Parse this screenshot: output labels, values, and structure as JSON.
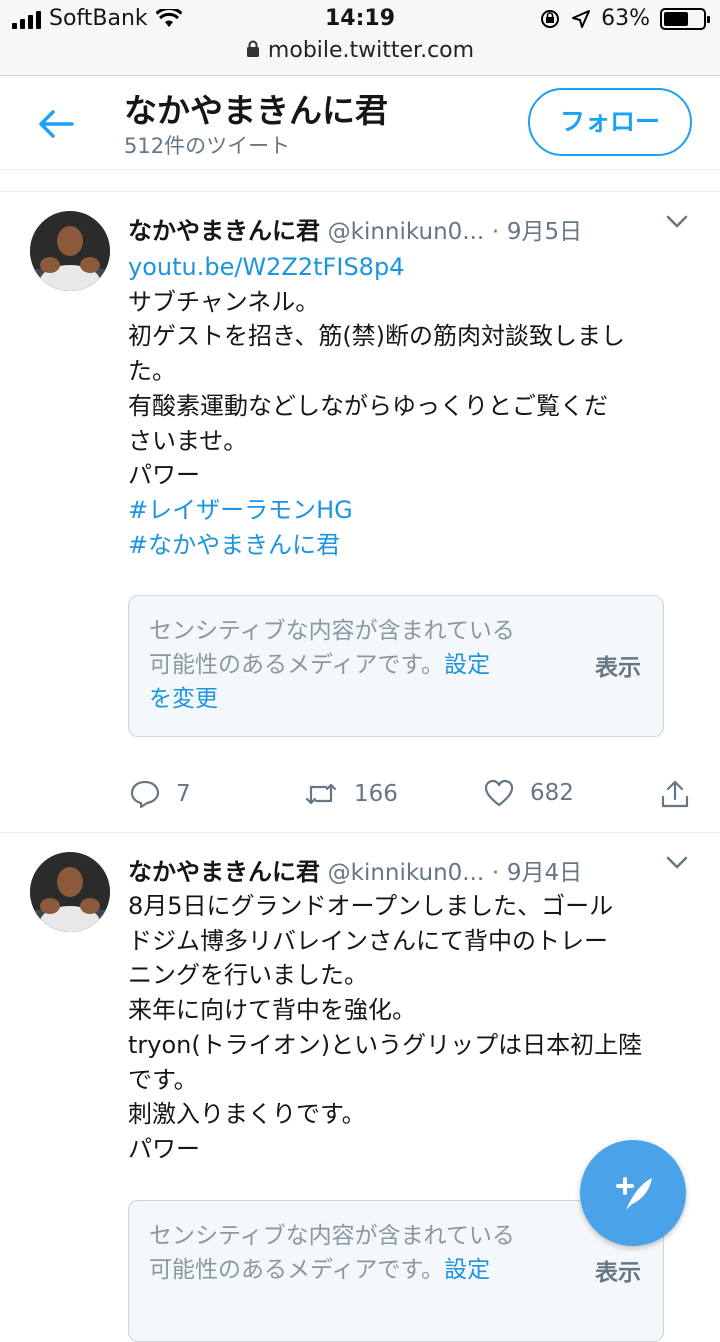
{
  "status_bar": {
    "carrier": "SoftBank",
    "time": "14:19",
    "battery": "63%",
    "battery_level": 0.63
  },
  "url_bar": {
    "host": "mobile.twitter.com"
  },
  "header": {
    "title": "なかやまきんに君",
    "subtitle": "512件のツイート",
    "follow_label": "フォロー"
  },
  "tweets": [
    {
      "name": "なかやまきんに君",
      "handle": "@kinnikun0...",
      "dot": "·",
      "date": "9月5日",
      "link": "youtu.be/W2Z2tFIS8p4",
      "lines": [
        "サブチャンネル。",
        "初ゲストを招き、筋(禁)断の筋肉対談致しまし",
        "た。",
        "有酸素運動などしながらゆっくりとご覧くだ",
        "さいませ。",
        "パワー"
      ],
      "hashtags": [
        "#レイザーラモンHG",
        "#なかやまきんに君"
      ],
      "media_notice_line1": "センシティブな内容が含まれている",
      "media_notice_line2": "可能性のあるメディアです。",
      "media_settings_1": "設定",
      "media_settings_2": "を変更",
      "media_show": "表示",
      "replies": "7",
      "retweets": "166",
      "likes": "682"
    },
    {
      "name": "なかやまきんに君",
      "handle": "@kinnikun0...",
      "dot": "·",
      "date": "9月4日",
      "lines": [
        "8月5日にグランドオープンしました、ゴール",
        "ドジム博多リバレインさんにて背中のトレー",
        "ニングを行いました。",
        "来年に向けて背中を強化。",
        "tryon(トライオン)というグリップは日本初上陸",
        "です。",
        "刺激入りまくりです。",
        "パワー"
      ],
      "media_notice_line1": "センシティブな内容が含まれている",
      "media_notice_line2": "可能性のあるメディアです。",
      "media_settings_1": "設定",
      "media_show": "表示"
    }
  ]
}
